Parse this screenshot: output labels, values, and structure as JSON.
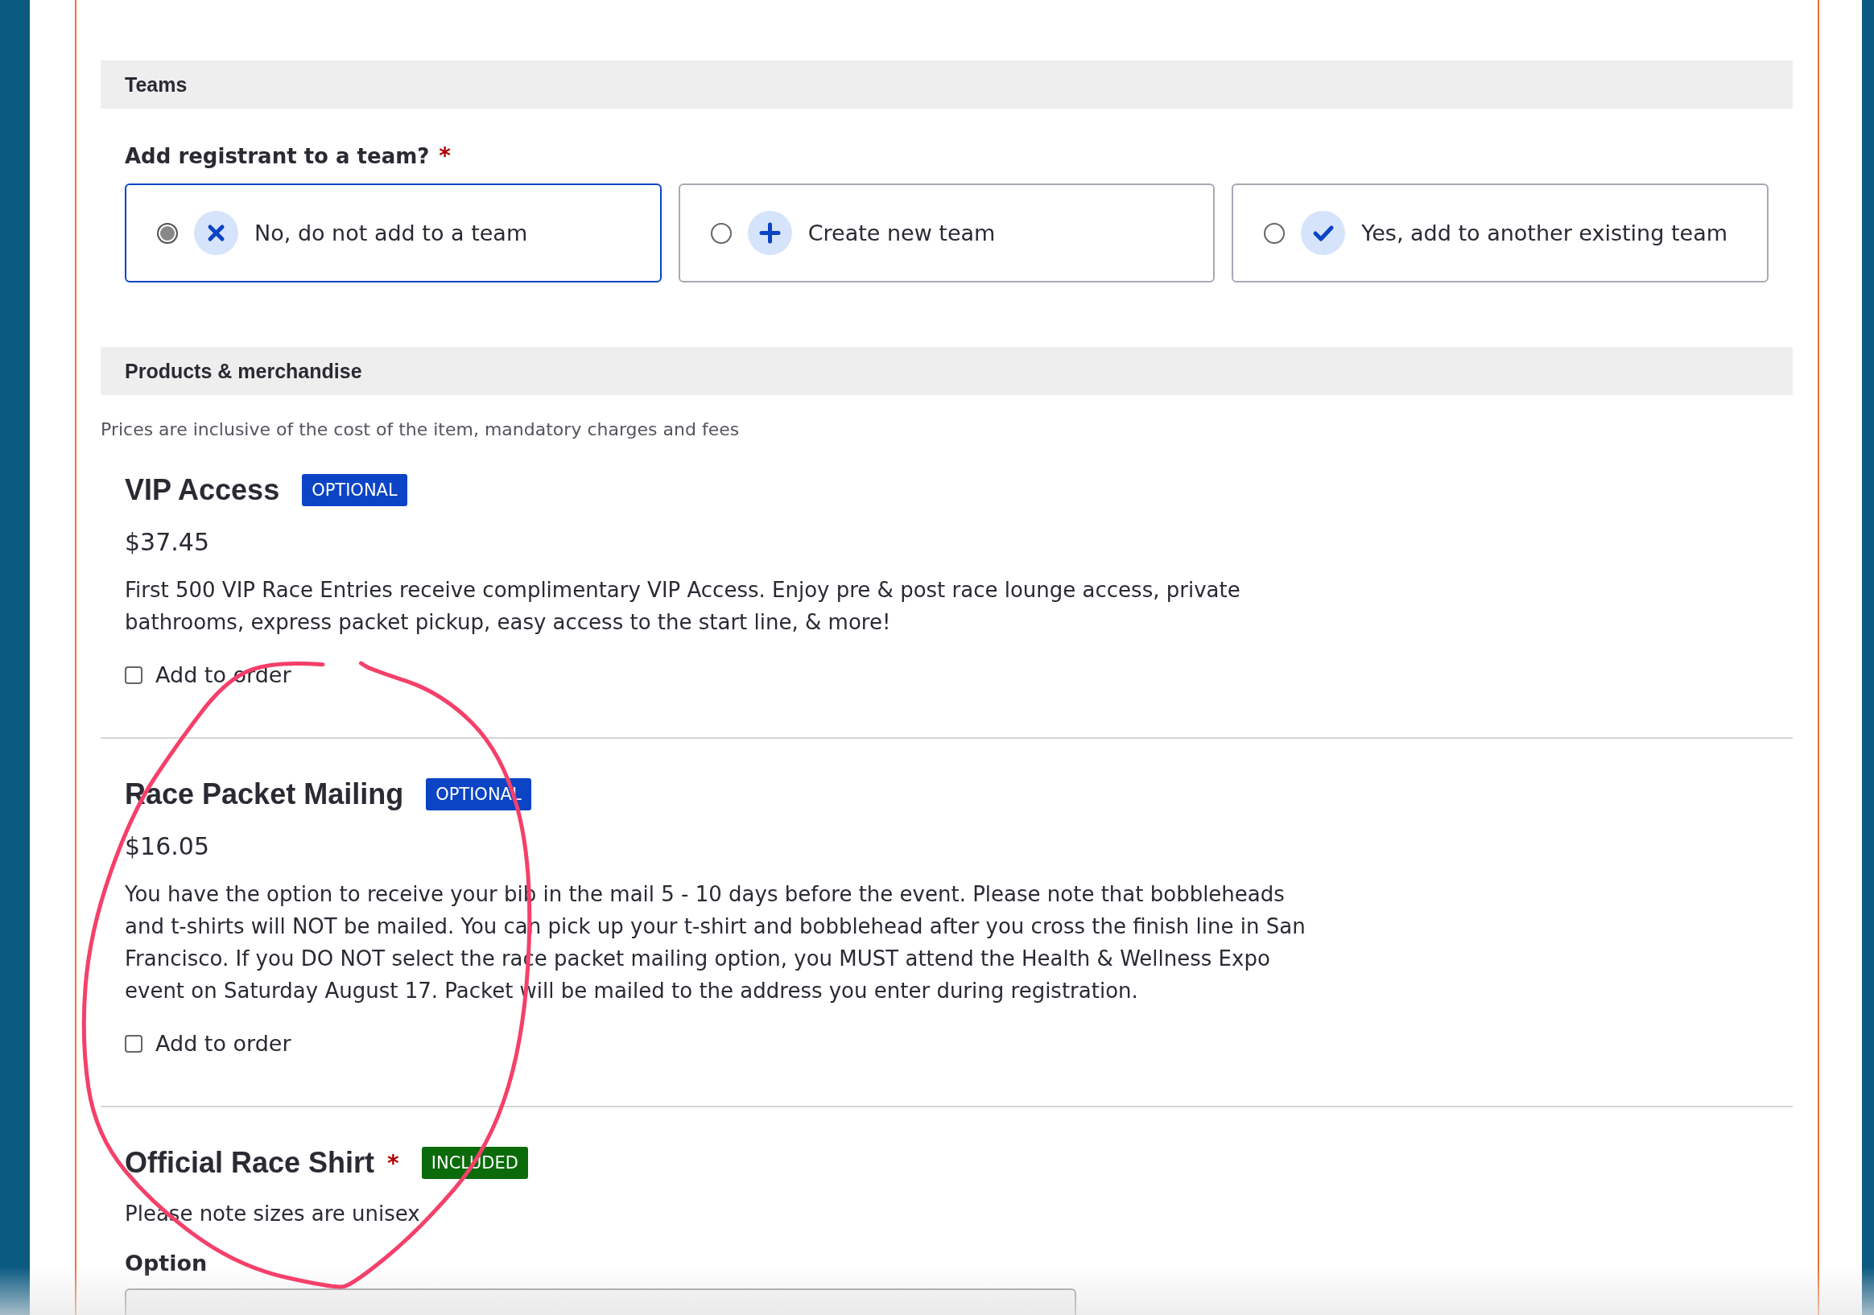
{
  "teams": {
    "heading": "Teams",
    "question": "Add registrant to a team?",
    "required_mark": "*",
    "options": [
      {
        "label": "No, do not add to a team",
        "kind": "none",
        "selected": true
      },
      {
        "label": "Create new team",
        "kind": "create",
        "selected": false
      },
      {
        "label": "Yes, add to another existing team",
        "kind": "existing",
        "selected": false
      }
    ]
  },
  "products": {
    "heading": "Products & merchandise",
    "note": "Prices are inclusive of the cost of the item, mandatory charges and fees",
    "items": [
      {
        "title": "VIP Access",
        "badge": {
          "label": "OPTIONAL",
          "color": "#0b44c4"
        },
        "price": "$37.45",
        "description": "First 500 VIP Race Entries receive complimentary VIP Access. Enjoy pre & post race lounge access, private bathrooms, express packet pickup, easy access to the start line, & more!",
        "checkbox": {
          "label": "Add to order",
          "checked": false
        }
      },
      {
        "title": "Race Packet Mailing",
        "badge": {
          "label": "OPTIONAL",
          "color": "#0b44c4"
        },
        "price": "$16.05",
        "description": "You have the option to receive your bib in the mail 5 - 10 days before the event. Please note that bobbleheads and t-shirts will NOT be mailed. You can pick up your t-shirt and bobblehead after you cross the finish line in San Francisco. If you DO NOT select the race packet mailing option, you MUST attend the Health & Wellness Expo event on Saturday August 17. Packet will be mailed to the address you enter during registration.",
        "checkbox": {
          "label": "Add to order",
          "checked": false
        }
      },
      {
        "title": "Official Race Shirt",
        "required_mark": "*",
        "badge": {
          "label": "INCLUDED",
          "color": "#0b6b0b"
        },
        "description": "Please note sizes are unisex",
        "field_label": "Option"
      }
    ]
  },
  "annotation": {
    "kind": "circle"
  }
}
